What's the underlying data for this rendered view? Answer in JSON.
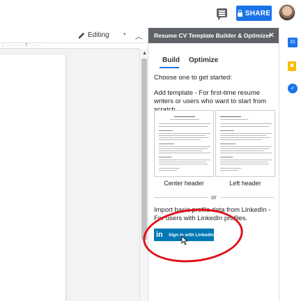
{
  "topbar": {
    "share_label": "SHARE"
  },
  "toolbar": {
    "mode_label": "Editing"
  },
  "ruler": {
    "mark": "7"
  },
  "sidebar": {
    "title": "Resume CV Template Builder & Optimizer",
    "close_glyph": "✕",
    "tabs": [
      {
        "label": "Build",
        "active": true
      },
      {
        "label": "Optimize",
        "active": false
      }
    ],
    "choose_text": "Choose one to get started:",
    "add_template_text": "Add template - For first-time resume writers or users who want to start from scratch.",
    "templates": [
      {
        "caption": "Center header"
      },
      {
        "caption": "Left header"
      }
    ],
    "or_text": "or",
    "import_text": "Import basic profile data from LinkedIn - For users with LinkedIn profiles.",
    "linkedin_button": {
      "logo": "in",
      "label": "Sign in with LinkedIn"
    }
  },
  "rail": {
    "calendar_label": "31"
  },
  "colors": {
    "accent": "#1a73e8",
    "linkedin": "#0077b5",
    "sidebar_header": "#5f6368",
    "annotation": "#e0121a"
  },
  "icons": [
    "comment-icon",
    "lock-icon",
    "pencil-icon",
    "chevron-up-icon",
    "close-icon",
    "calendar-icon",
    "keep-icon",
    "tasks-icon",
    "cursor-icon"
  ]
}
